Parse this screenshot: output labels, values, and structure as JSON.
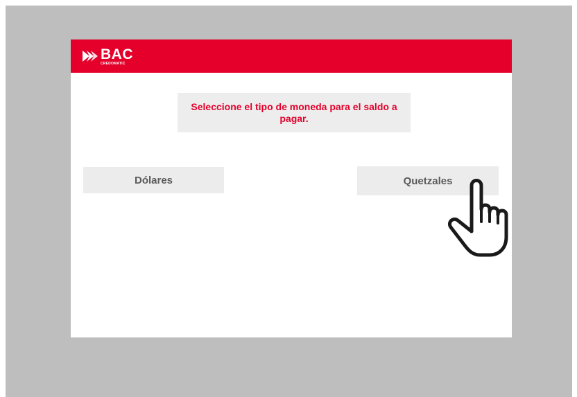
{
  "header": {
    "brand": "BAC",
    "brand_sub": "CREDOMATIC",
    "color": "#e4002b"
  },
  "prompt": {
    "text": "Seleccione el tipo de moneda para el saldo a pagar."
  },
  "options": [
    {
      "label": "Dólares"
    },
    {
      "label": "Quetzales"
    }
  ],
  "pointer": {
    "icon": "pointing-hand-icon"
  }
}
